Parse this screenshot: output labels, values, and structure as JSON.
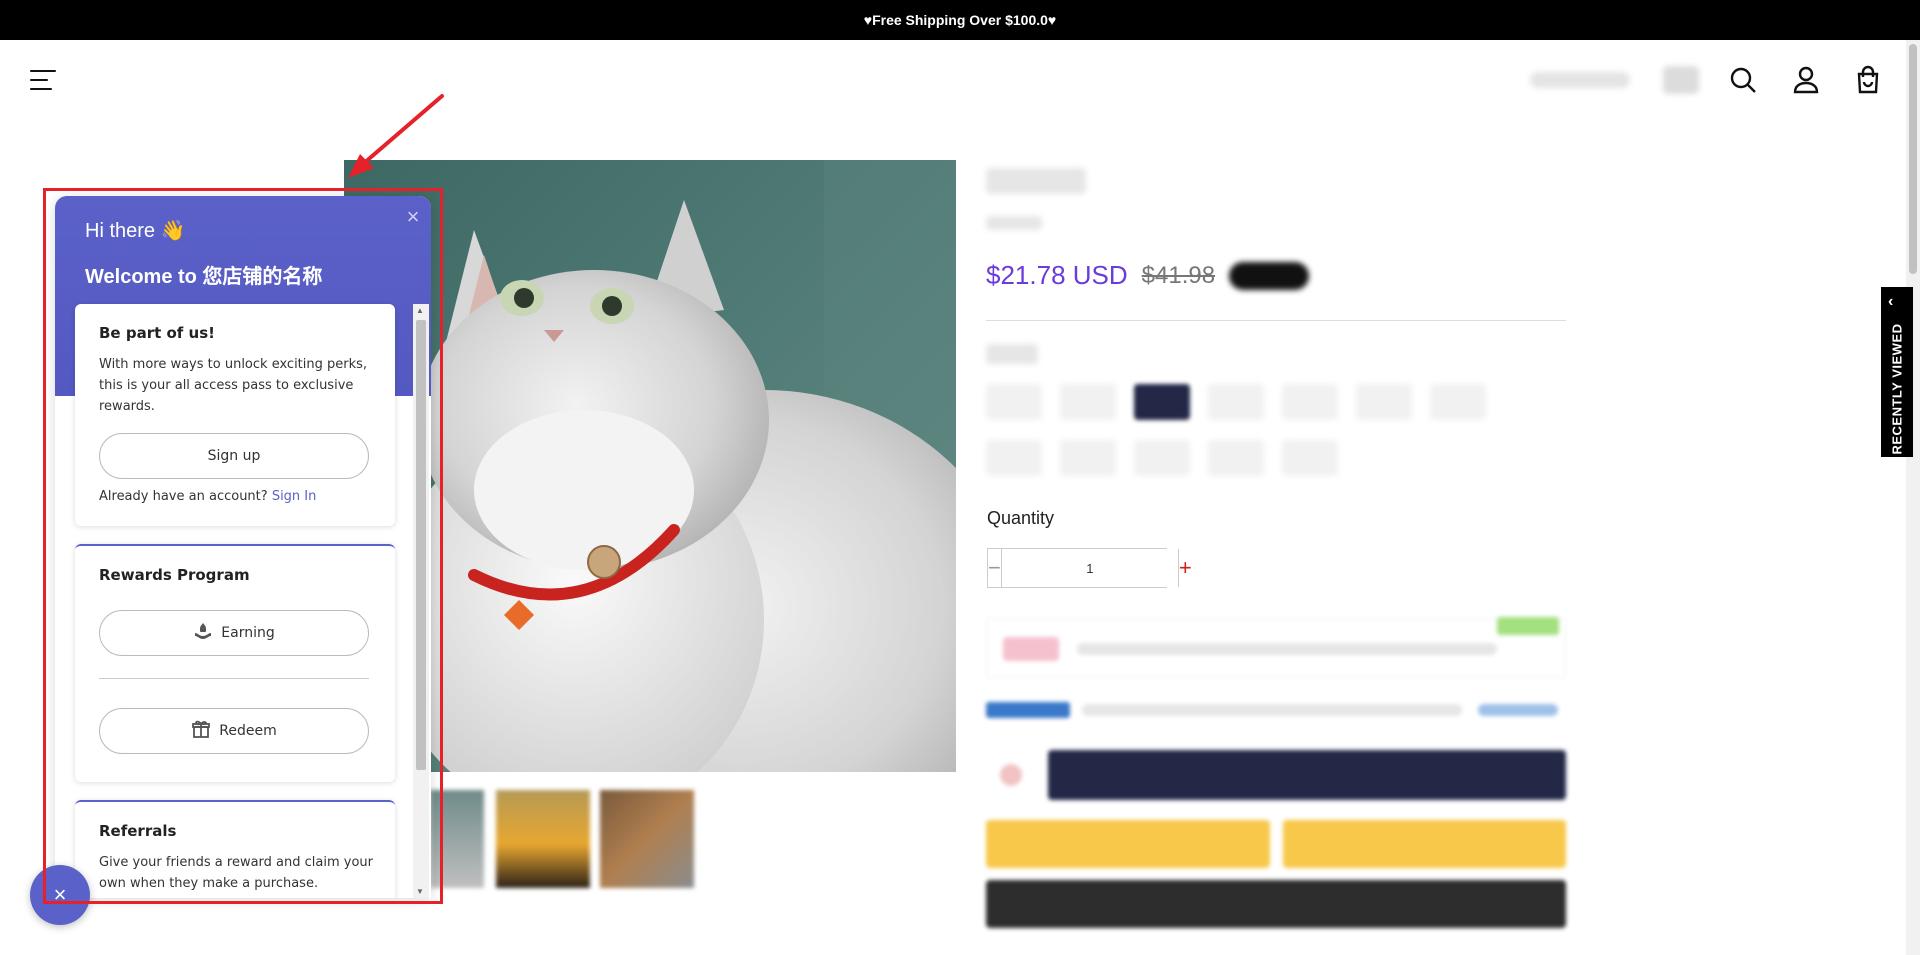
{
  "announcement": {
    "text": "♥Free Shipping Over $100.0♥"
  },
  "header": {
    "icons": [
      "menu-icon",
      "search-icon",
      "account-icon",
      "cart-icon"
    ]
  },
  "product": {
    "price": "$21.78 USD",
    "compare_price": "$41.98",
    "quantity_label": "Quantity",
    "quantity_value": "1",
    "minus_symbol": "−",
    "plus_symbol": "+"
  },
  "recently_viewed": {
    "label": "RECENTLY VIEWED",
    "arrow": "‹"
  },
  "rewards_widget": {
    "greeting": "Hi there 👋",
    "welcome": "Welcome to 您店铺的名称",
    "close_symbol": "×",
    "join_card": {
      "title": "Be part of us!",
      "description": "With more ways to unlock exciting perks, this is your all access pass to exclusive rewards.",
      "signup_label": "Sign up",
      "signin_prompt": "Already have an account?",
      "signin_link": "Sign In"
    },
    "rewards_card": {
      "title": "Rewards Program",
      "earning_label": "Earning",
      "redeem_label": "Redeem"
    },
    "referrals_card": {
      "title": "Referrals",
      "description": "Give your friends a reward and claim your own when they make a purchase."
    },
    "launcher_symbol": "×"
  },
  "colors": {
    "accent": "#5a61c8",
    "price": "#6b3bdc",
    "annotation": "#e5212a",
    "topbar": "#000000"
  }
}
